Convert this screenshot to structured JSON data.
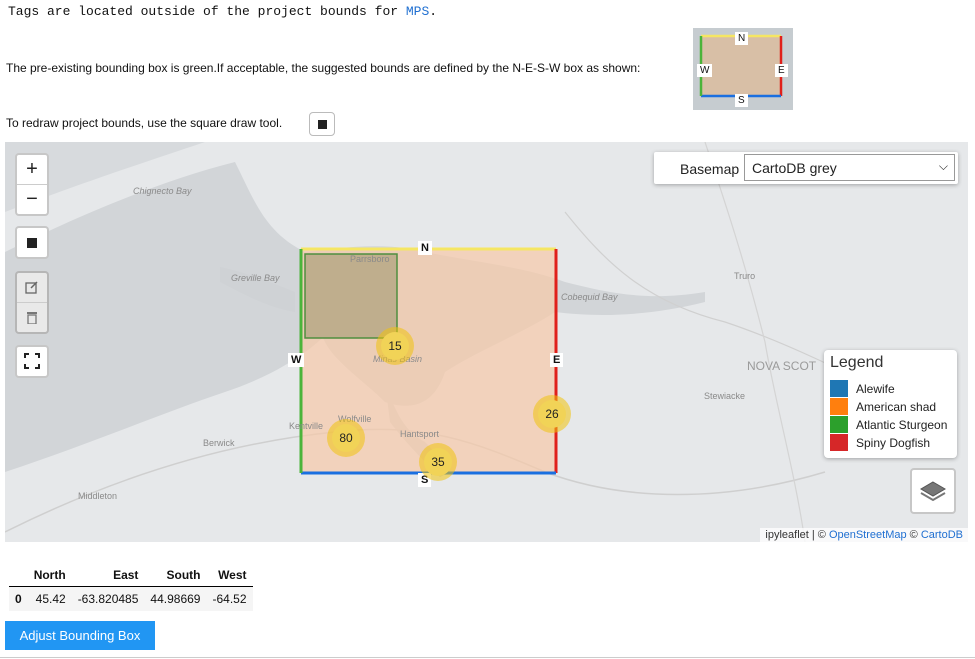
{
  "warning": {
    "prefix": "Tags are located outside of the project bounds for ",
    "project": "MPS",
    "suffix": "."
  },
  "description": "The pre-existing bounding box is green.If acceptable, the suggested bounds are defined by the N-E-S-W box as shown:",
  "thumbnail": {
    "n": "N",
    "e": "E",
    "s": "S",
    "w": "W"
  },
  "redraw_text": "To redraw project bounds, use the square draw tool.",
  "map": {
    "zoom_in": "+",
    "zoom_out": "−",
    "basemap_label": "Basemap",
    "basemap_selected": "CartoDB grey",
    "direction_labels": {
      "n": "N",
      "e": "E",
      "s": "S",
      "w": "W"
    },
    "clusters": [
      "15",
      "26",
      "80",
      "35"
    ],
    "places": {
      "chignecto": "Chignecto Bay",
      "greville": "Greville Bay",
      "parrsboro": "Parrsboro",
      "cobequid": "Cobequid Bay",
      "truro": "Truro",
      "minas": "Minas Basin",
      "nova": "NOVA SCOT",
      "stewiacke": "Stewiacke",
      "wolfville": "Wolfville",
      "kentville": "Kentville",
      "hantsport": "Hantsport",
      "berwick": "Berwick",
      "middleton": "Middleton"
    },
    "legend": {
      "title": "Legend",
      "items": [
        {
          "label": "Alewife",
          "color": "#1f77b4"
        },
        {
          "label": "American shad",
          "color": "#ff7f0e"
        },
        {
          "label": "Atlantic Sturgeon",
          "color": "#2ca02c"
        },
        {
          "label": "Spiny Dogfish",
          "color": "#d62728"
        }
      ]
    },
    "attribution": {
      "prefix": "ipyleaflet | © ",
      "osm": "OpenStreetMap",
      "sep": " © ",
      "carto": "CartoDB"
    },
    "colors": {
      "north": "#f5e663",
      "east": "#e0201b",
      "south": "#1a6fe0",
      "west": "#4bb43a",
      "fill": "#f6c9a8"
    }
  },
  "table": {
    "columns": [
      "",
      "North",
      "East",
      "South",
      "West"
    ],
    "rows": [
      [
        "0",
        "45.42",
        "-63.820485",
        "44.98669",
        "-64.52"
      ]
    ]
  },
  "adjust_button": "Adjust Bounding Box"
}
